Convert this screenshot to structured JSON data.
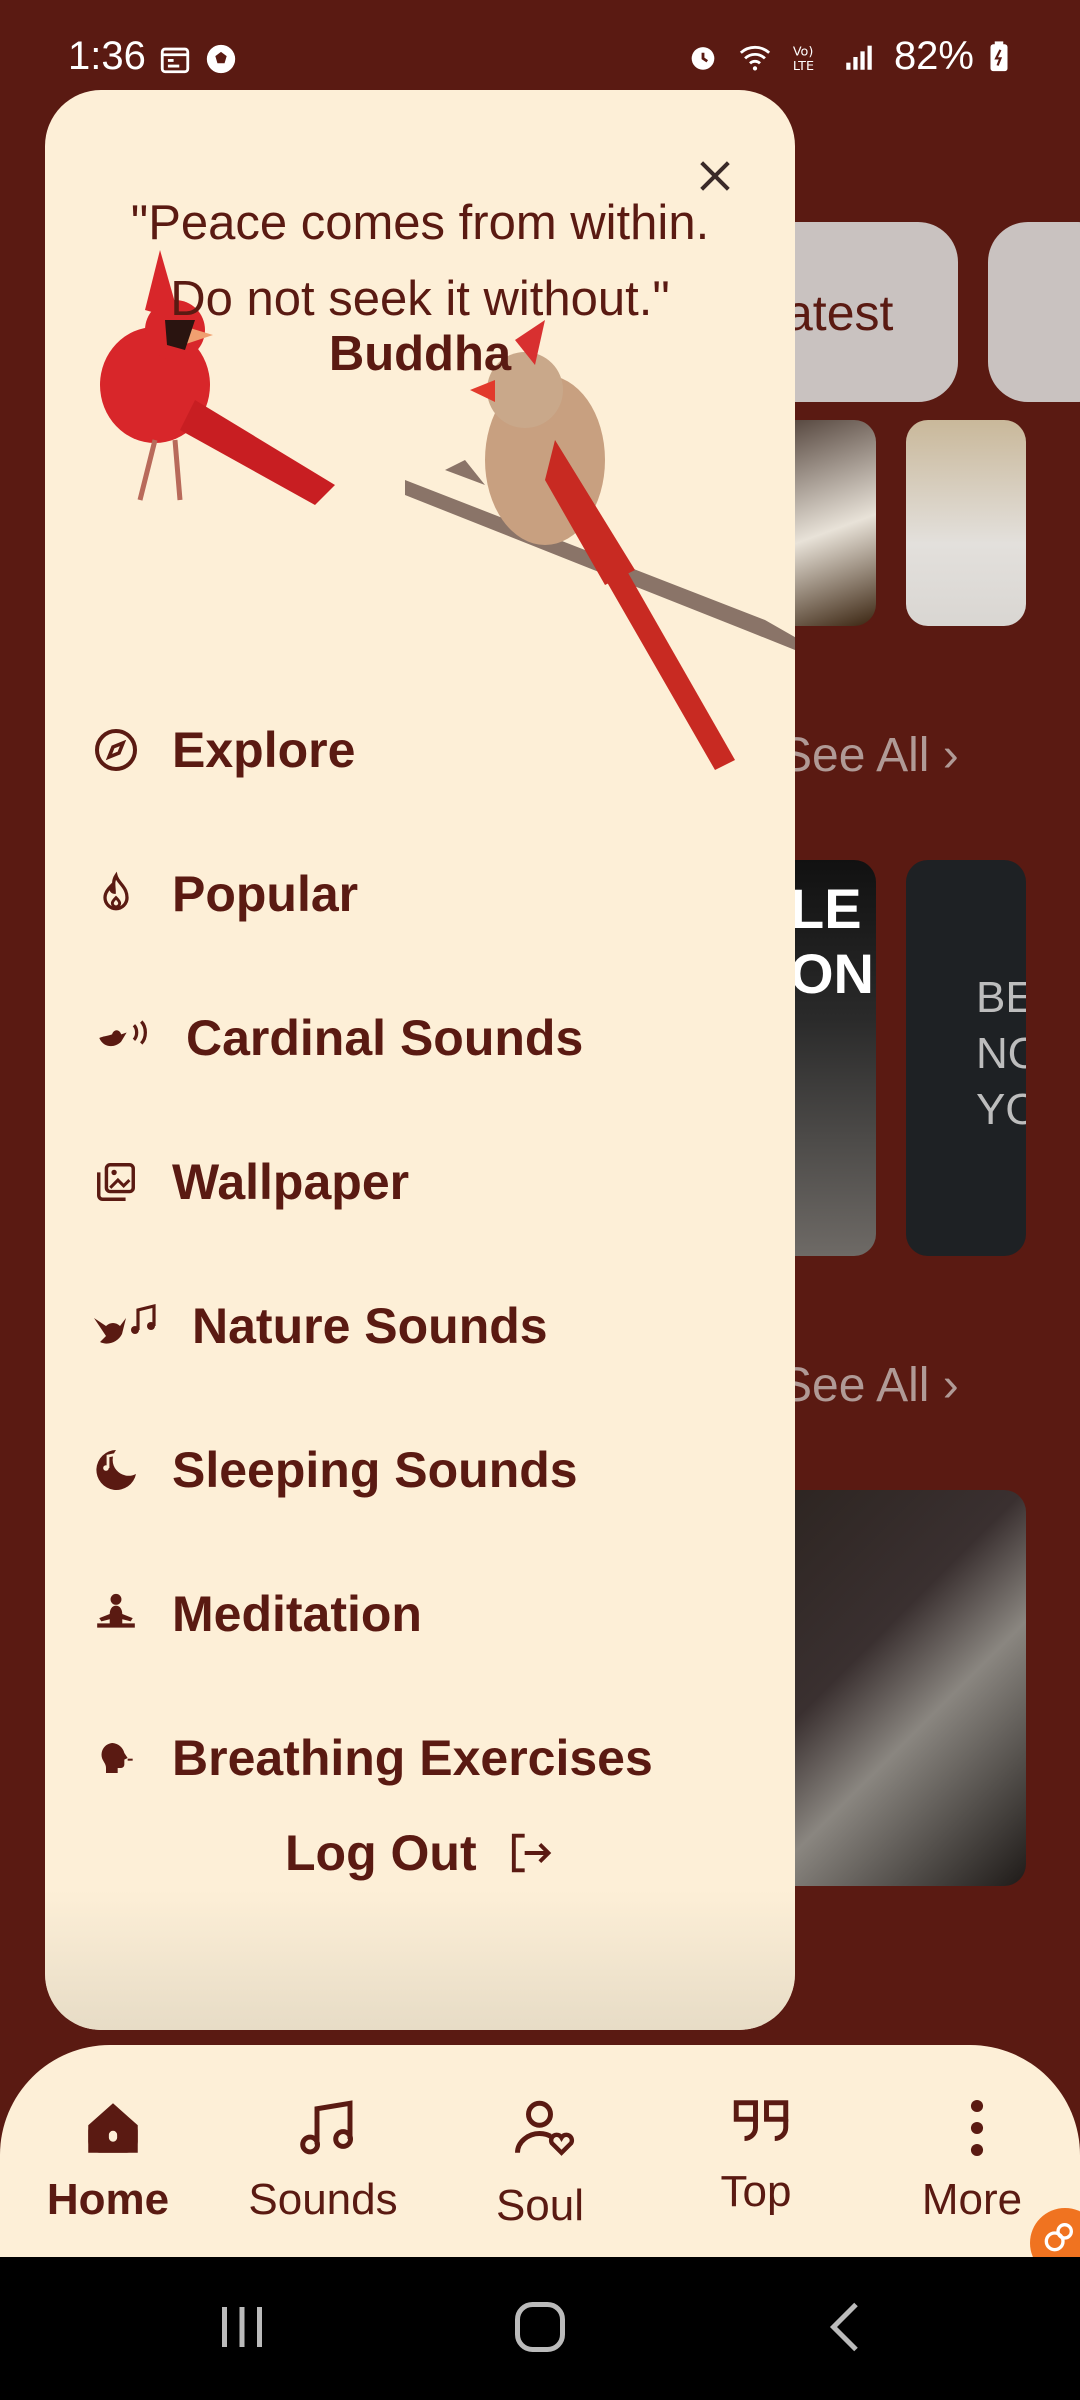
{
  "status_bar": {
    "time": "1:36",
    "battery": "82%",
    "icons_left": [
      "calendar-icon",
      "soccer-ball-icon"
    ],
    "icons_right": [
      "alarm-icon",
      "wifi-icon",
      "volte-icon",
      "signal-icon",
      "battery-icon"
    ]
  },
  "background": {
    "chip_latest": "atest",
    "see_all_1": "See All",
    "see_all_2": "See All",
    "tile3_text": "LE\nONG",
    "tile4_text": "BE\nNOBO\nYOU"
  },
  "drawer": {
    "quote": "\"Peace comes from within.\nDo not seek it without.\"",
    "author": "Buddha",
    "menu": [
      {
        "label": "Explore",
        "icon": "compass-icon"
      },
      {
        "label": "Popular",
        "icon": "flame-icon"
      },
      {
        "label": "Cardinal Sounds",
        "icon": "bird-sound-icon"
      },
      {
        "label": "Wallpaper",
        "icon": "gallery-icon"
      },
      {
        "label": "Nature Sounds",
        "icon": "bird-music-icon"
      },
      {
        "label": "Sleeping Sounds",
        "icon": "moon-music-icon"
      },
      {
        "label": "Meditation",
        "icon": "meditation-icon"
      },
      {
        "label": "Breathing Exercises",
        "icon": "breathing-head-icon"
      }
    ],
    "logout": "Log Out"
  },
  "bottom_nav": [
    {
      "label": "Home",
      "icon": "home-icon",
      "active": true
    },
    {
      "label": "Sounds",
      "icon": "music-note-icon",
      "active": false
    },
    {
      "label": "Soul",
      "icon": "person-heart-icon",
      "active": false
    },
    {
      "label": "Top",
      "icon": "quote-icon",
      "active": false
    },
    {
      "label": "More",
      "icon": "more-vert-icon",
      "active": false
    }
  ],
  "colors": {
    "background": "#5a1a12",
    "drawer": "#fdefd7",
    "text": "#5a1a12",
    "accent": "#f07320"
  }
}
